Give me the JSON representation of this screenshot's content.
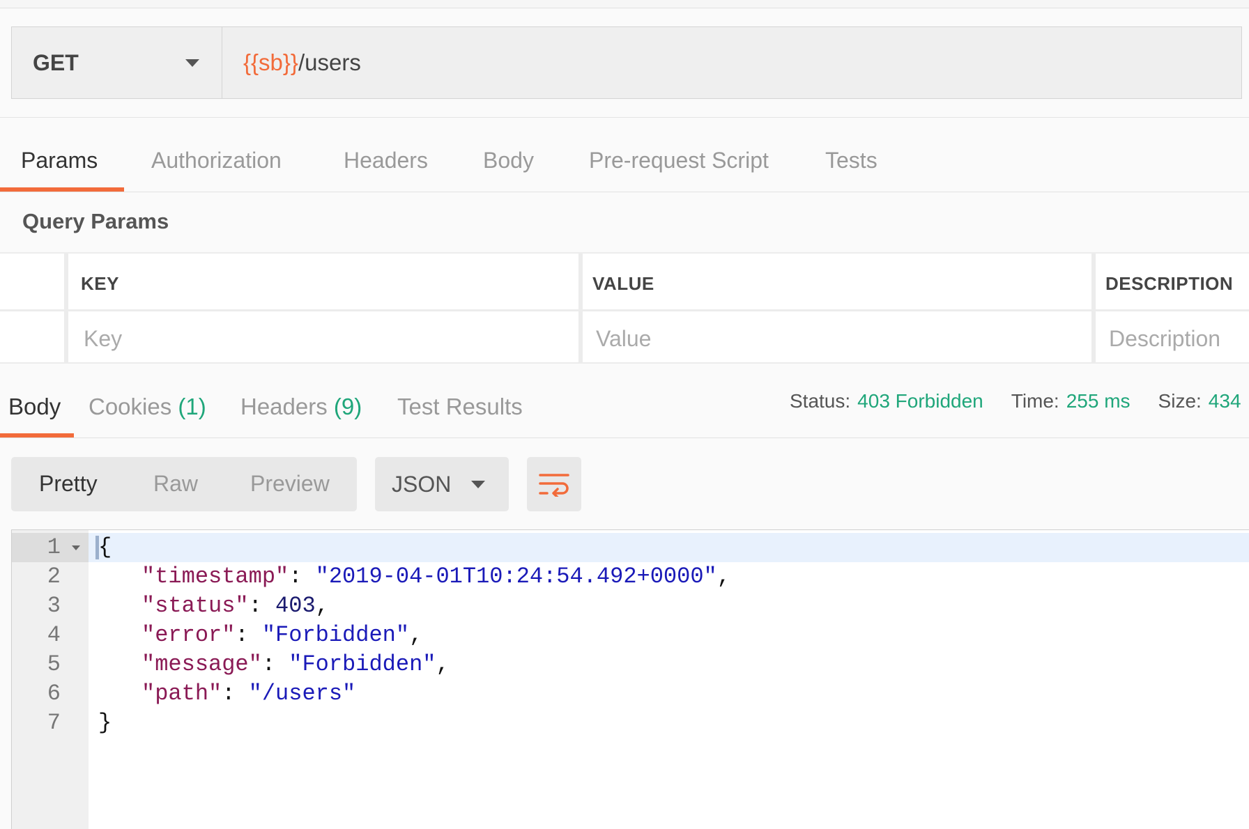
{
  "request": {
    "method": "GET",
    "url_variable": "{{sb}}",
    "url_path": "/users"
  },
  "request_tabs": [
    {
      "label": "Params",
      "active": true
    },
    {
      "label": "Authorization",
      "active": false
    },
    {
      "label": "Headers",
      "active": false
    },
    {
      "label": "Body",
      "active": false
    },
    {
      "label": "Pre-request Script",
      "active": false
    },
    {
      "label": "Tests",
      "active": false
    }
  ],
  "query_params": {
    "title": "Query Params",
    "columns": [
      "KEY",
      "VALUE",
      "DESCRIPTION"
    ],
    "placeholders": [
      "Key",
      "Value",
      "Description"
    ]
  },
  "response_tabs": [
    {
      "label": "Body",
      "count": "",
      "active": true
    },
    {
      "label": "Cookies",
      "count": "(1)",
      "active": false
    },
    {
      "label": "Headers",
      "count": "(9)",
      "active": false
    },
    {
      "label": "Test Results",
      "count": "",
      "active": false
    }
  ],
  "response_meta": {
    "status_label": "Status:",
    "status_value": "403 Forbidden",
    "time_label": "Time:",
    "time_value": "255 ms",
    "size_label": "Size:",
    "size_value": "434"
  },
  "view_modes": [
    "Pretty",
    "Raw",
    "Preview"
  ],
  "format": "JSON",
  "icons": {
    "method_dropdown": "chevron-down-icon",
    "wrap": "wrap-lines-icon",
    "fold": "fold-arrow-icon"
  },
  "colors": {
    "accent": "#f26b3a",
    "success": "#1fa67a",
    "json_key": "#8a1a55",
    "json_string": "#1a1ab8"
  },
  "code": {
    "line_numbers": [
      "1",
      "2",
      "3",
      "4",
      "5",
      "6",
      "7"
    ],
    "open_brace": "{",
    "close_brace": "}",
    "entries": [
      {
        "key": "\"timestamp\"",
        "value": "\"2019-04-01T10:24:54.492+0000\"",
        "type": "string",
        "trail": ","
      },
      {
        "key": "\"status\"",
        "value": "403",
        "type": "number",
        "trail": ","
      },
      {
        "key": "\"error\"",
        "value": "\"Forbidden\"",
        "type": "string",
        "trail": ","
      },
      {
        "key": "\"message\"",
        "value": "\"Forbidden\"",
        "type": "string",
        "trail": ","
      },
      {
        "key": "\"path\"",
        "value": "\"/users\"",
        "type": "string",
        "trail": ""
      }
    ]
  }
}
